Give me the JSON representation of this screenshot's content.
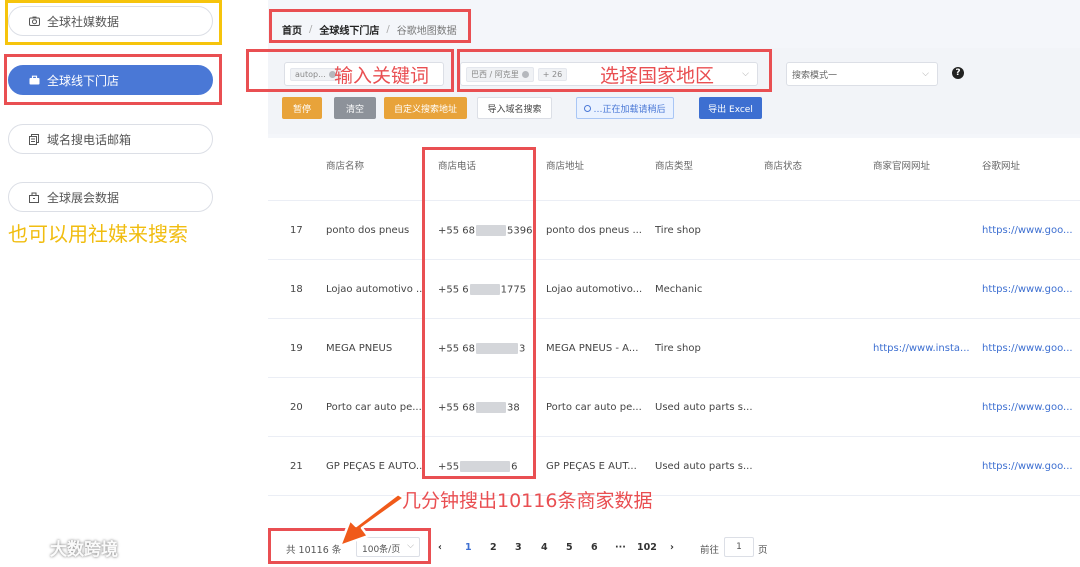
{
  "sidebar": {
    "items": [
      {
        "label": "全球社媒数据",
        "icon": "camera-icon"
      },
      {
        "label": "全球线下门店",
        "icon": "store-icon"
      },
      {
        "label": "域名搜电话邮箱",
        "icon": "document-icon"
      },
      {
        "label": "全球展会数据",
        "icon": "bag-icon"
      }
    ]
  },
  "breadcrumb": {
    "home": "首页",
    "section": "全球线下门店",
    "current": "谷歌地图数据",
    "separator": "/"
  },
  "filters": {
    "keyword_tag": "autop...",
    "region_tag": "巴西 / 阿克里",
    "region_more": "+ 26",
    "search_mode": "搜索模式一",
    "help": "?"
  },
  "buttons": {
    "pause": "暂停",
    "clear": "清空",
    "custom_address": "自定义搜索地址",
    "import_domain": "导入域名搜索",
    "loading": "…正在加载请稍后",
    "export": "导出 Excel"
  },
  "table": {
    "columns": [
      "商店名称",
      "商店电话",
      "商店地址",
      "商店类型",
      "商店状态",
      "商家官网网址",
      "谷歌网址"
    ],
    "rows": [
      {
        "no": "17",
        "name": "ponto dos pneus",
        "phone_a": "+55 68",
        "phone_b": "5396",
        "address": "ponto dos pneus ...",
        "type": "Tire shop",
        "status": "",
        "website": "",
        "google": "https://www.goo..."
      },
      {
        "no": "18",
        "name": "Lojao automotivo ...",
        "phone_a": "+55 6",
        "phone_b": "1775",
        "address": "Lojao automotivo...",
        "type": "Mechanic",
        "status": "",
        "website": "",
        "google": "https://www.goo..."
      },
      {
        "no": "19",
        "name": "MEGA PNEUS",
        "phone_a": "+55 68",
        "phone_b": "3",
        "address": "MEGA PNEUS - A...",
        "type": "Tire shop",
        "status": "",
        "website": "https://www.insta...",
        "google": "https://www.goo..."
      },
      {
        "no": "20",
        "name": "Porto car auto pe...",
        "phone_a": "+55 68",
        "phone_b": "38",
        "address": "Porto car auto pe...",
        "type": "Used auto parts s...",
        "status": "",
        "website": "",
        "google": "https://www.goo..."
      },
      {
        "no": "21",
        "name": "GP PEÇAS E AUTO...",
        "phone_a": "+55",
        "phone_b": "6",
        "address": "GP PEÇAS E AUT...",
        "type": "Used auto parts s...",
        "status": "",
        "website": "",
        "google": "https://www.goo..."
      }
    ]
  },
  "pagination": {
    "total": "共 10116 条",
    "page_size": "100条/页",
    "pages": [
      "1",
      "2",
      "3",
      "4",
      "5",
      "6",
      "···",
      "102"
    ],
    "goto_label": "前往",
    "goto_value": "1",
    "page_unit": "页"
  },
  "annotations": {
    "keyword": "输入关键词",
    "region": "选择国家地区",
    "social": "也可以用社媒来搜索",
    "result": "几分钟搜出10116条商家数据"
  },
  "watermark": "大数跨境",
  "colors": {
    "annotation_red": "#e94f52",
    "annotation_yellow": "#f6c40c",
    "primary_blue": "#4a78d6",
    "warn_orange": "#e8a33a"
  }
}
